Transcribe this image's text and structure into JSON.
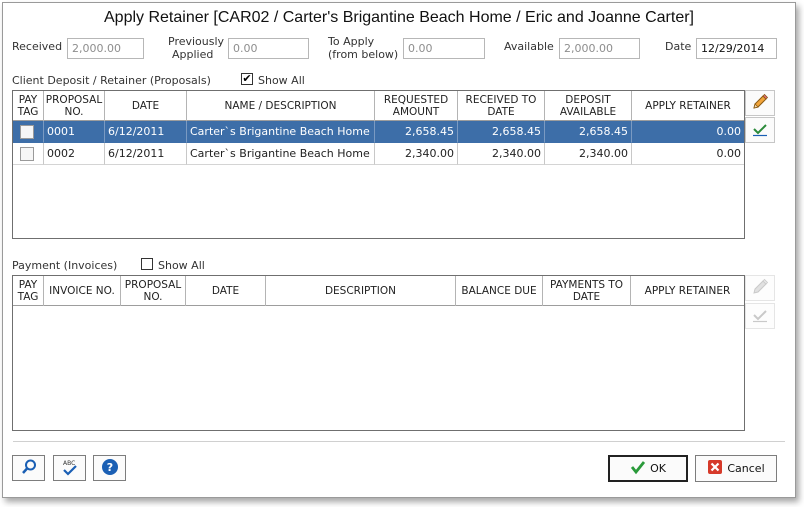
{
  "window": {
    "title": "Apply Retainer [CAR02 / Carter's Brigantine Beach Home / Eric and Joanne Carter]"
  },
  "summary": {
    "received_label": "Received",
    "received_value": "2,000.00",
    "prev_applied_label_1": "Previously",
    "prev_applied_label_2": "Applied",
    "prev_applied_value": "0.00",
    "to_apply_label_1": "To Apply",
    "to_apply_label_2": "(from below)",
    "to_apply_value": "0.00",
    "available_label": "Available",
    "available_value": "2,000.00",
    "date_label": "Date",
    "date_value": "12/29/2014"
  },
  "proposals": {
    "section_label": "Client Deposit / Retainer (Proposals)",
    "show_all_label": "Show All",
    "show_all_checked": true,
    "headers": {
      "pay_tag_1": "PAY",
      "pay_tag_2": "TAG",
      "proposal_no_1": "PROPOSAL",
      "proposal_no_2": "NO.",
      "date": "DATE",
      "name": "NAME / DESCRIPTION",
      "requested_1": "REQUESTED",
      "requested_2": "AMOUNT",
      "received_1": "RECEIVED TO",
      "received_2": "DATE",
      "deposit_1": "DEPOSIT",
      "deposit_2": "AVAILABLE",
      "apply": "APPLY RETAINER"
    },
    "rows": [
      {
        "proposal_no": "0001",
        "date": "6/12/2011",
        "name": "Carter`s Brigantine Beach Home",
        "requested": "2,658.45",
        "received": "2,658.45",
        "deposit": "2,658.45",
        "apply": "0.00",
        "selected": true
      },
      {
        "proposal_no": "0002",
        "date": "6/12/2011",
        "name": "Carter`s Brigantine Beach Home",
        "requested": "2,340.00",
        "received": "2,340.00",
        "deposit": "2,340.00",
        "apply": "0.00",
        "selected": false
      }
    ]
  },
  "invoices": {
    "section_label": "Payment (Invoices)",
    "show_all_label": "Show All",
    "show_all_checked": false,
    "headers": {
      "pay_tag_1": "PAY",
      "pay_tag_2": "TAG",
      "invoice_no": "INVOICE NO.",
      "proposal_no_1": "PROPOSAL",
      "proposal_no_2": "NO.",
      "date": "DATE",
      "description": "DESCRIPTION",
      "balance_due": "BALANCE DUE",
      "payments_1": "PAYMENTS TO",
      "payments_2": "DATE",
      "apply": "APPLY RETAINER"
    },
    "rows": []
  },
  "footer": {
    "ok_label": "OK",
    "cancel_label": "Cancel"
  },
  "colors": {
    "selection": "#3d6ea8",
    "ok_check": "#2a9a3a",
    "cancel_x": "#d63a2a",
    "help": "#1a5fb4"
  },
  "icons": [
    "pencil-icon",
    "checkmark-icon",
    "search-icon",
    "spellcheck-icon",
    "help-icon",
    "ok-check-icon",
    "cancel-x-icon"
  ]
}
